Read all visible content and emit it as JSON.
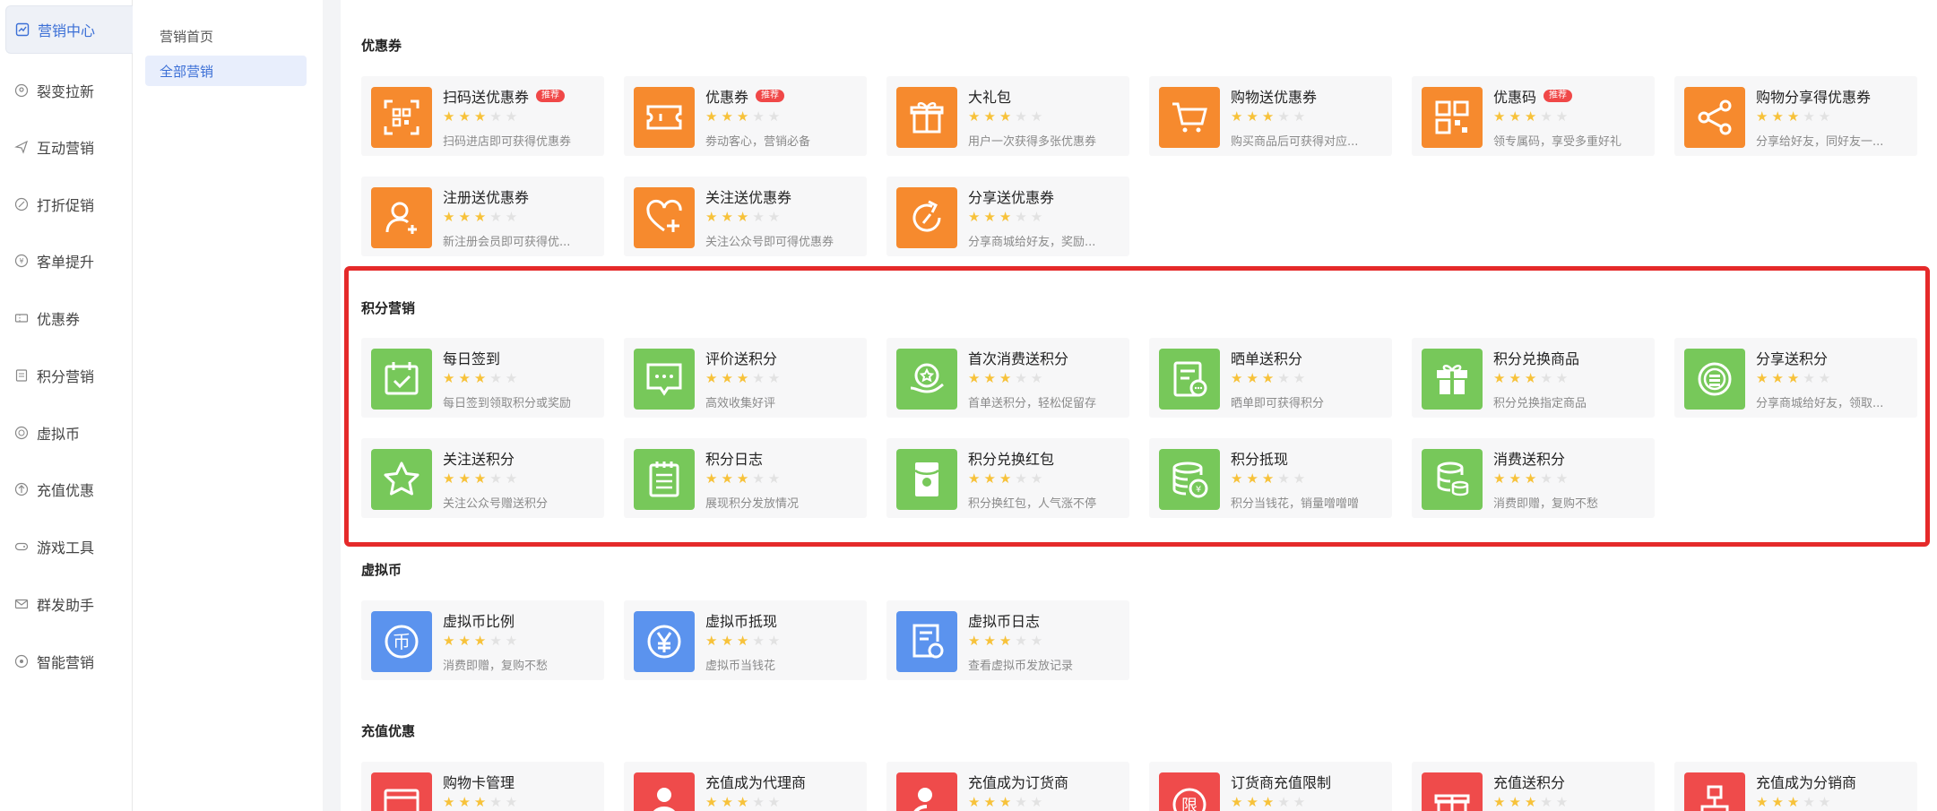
{
  "nav_primary": [
    {
      "label": "营销中心",
      "icon": "chart-icon",
      "active": true
    },
    {
      "label": "裂变拉新",
      "icon": "people-icon"
    },
    {
      "label": "互动营销",
      "icon": "send-icon"
    },
    {
      "label": "打折促销",
      "icon": "discount-icon"
    },
    {
      "label": "客单提升",
      "icon": "coin-icon"
    },
    {
      "label": "优惠券",
      "icon": "ticket-icon"
    },
    {
      "label": "积分营销",
      "icon": "points-icon"
    },
    {
      "label": "虚拟币",
      "icon": "virtual-coin-icon"
    },
    {
      "label": "充值优惠",
      "icon": "recharge-icon"
    },
    {
      "label": "游戏工具",
      "icon": "gamepad-icon"
    },
    {
      "label": "群发助手",
      "icon": "mail-icon"
    },
    {
      "label": "智能营销",
      "icon": "smart-icon"
    }
  ],
  "nav_secondary": [
    {
      "label": "营销首页"
    },
    {
      "label": "全部营销",
      "active": true
    }
  ],
  "colors": {
    "orange": "#f68a2e",
    "green": "#77c85a",
    "blue": "#5b93ee",
    "red": "#ef4b4b",
    "highlight": "#e52a2a",
    "accent": "#3b6fd6"
  },
  "sections": [
    {
      "title": "优惠券",
      "cards": [
        {
          "name": "扫码送优惠券",
          "badge": "推荐",
          "desc": "扫码进店即可获得优惠券",
          "rating": 3,
          "icon": "qr-scan-icon"
        },
        {
          "name": "优惠券",
          "badge": "推荐",
          "desc": "劵动客心，营销必备",
          "rating": 3,
          "icon": "ticket-icon"
        },
        {
          "name": "大礼包",
          "desc": "用户一次获得多张优惠券",
          "rating": 3,
          "icon": "gift-icon"
        },
        {
          "name": "购物送优惠券",
          "desc": "购买商品后可获得对应...",
          "rating": 3,
          "icon": "cart-icon"
        },
        {
          "name": "优惠码",
          "badge": "推荐",
          "desc": "领专属码，享受多重好礼",
          "rating": 3,
          "icon": "qr-code-icon"
        },
        {
          "name": "购物分享得优惠券",
          "desc": "分享给好友，同好友一...",
          "rating": 3,
          "icon": "share-icon"
        },
        {
          "name": "注册送优惠券",
          "desc": "新注册会员即可获得优...",
          "rating": 3,
          "icon": "user-add-icon"
        },
        {
          "name": "关注送优惠券",
          "desc": "关注公众号即可得优惠券",
          "rating": 3,
          "icon": "heart-add-icon"
        },
        {
          "name": "分享送优惠券",
          "desc": "分享商城给好友，奖励...",
          "rating": 3,
          "icon": "refresh-share-icon"
        }
      ]
    },
    {
      "title": "积分营销",
      "cards": [
        {
          "name": "每日签到",
          "desc": "每日签到领取积分或奖励",
          "rating": 3,
          "icon": "calendar-check-icon"
        },
        {
          "name": "评价送积分",
          "desc": "高效收集好评",
          "rating": 3,
          "icon": "comment-icon"
        },
        {
          "name": "首次消费送积分",
          "desc": "首单送积分，轻松促留存",
          "rating": 3,
          "icon": "star-hand-icon"
        },
        {
          "name": "晒单送积分",
          "desc": "晒单即可获得积分",
          "rating": 3,
          "icon": "receipt-icon"
        },
        {
          "name": "积分兑换商品",
          "desc": "积分兑换指定商品",
          "rating": 3,
          "icon": "gift-box-icon"
        },
        {
          "name": "分享送积分",
          "desc": "分享商城给好友，领取...",
          "rating": 3,
          "icon": "coins-icon"
        },
        {
          "name": "关注送积分",
          "desc": "关注公众号赠送积分",
          "rating": 3,
          "icon": "star-outline-icon"
        },
        {
          "name": "积分日志",
          "desc": "展现积分发放情况",
          "rating": 3,
          "icon": "log-icon"
        },
        {
          "name": "积分兑换红包",
          "desc": "积分换红包，人气涨不停",
          "rating": 3,
          "icon": "red-packet-icon"
        },
        {
          "name": "积分抵现",
          "desc": "积分当钱花，销量噌噌噌",
          "rating": 3,
          "icon": "coin-stack-icon"
        },
        {
          "name": "消费送积分",
          "desc": "消费即赠，复购不愁",
          "rating": 3,
          "icon": "database-icon"
        }
      ]
    },
    {
      "title": "虚拟币",
      "cards": [
        {
          "name": "虚拟币比例",
          "desc": "消费即赠，复购不愁",
          "rating": 3,
          "icon": "currency-icon"
        },
        {
          "name": "虚拟币抵现",
          "desc": "虚拟币当钱花",
          "rating": 3,
          "icon": "yen-icon"
        },
        {
          "name": "虚拟币日志",
          "desc": "查看虚拟币发放记录",
          "rating": 3,
          "icon": "doc-record-icon"
        }
      ]
    },
    {
      "title": "充值优惠",
      "cards": [
        {
          "name": "购物卡管理",
          "desc": "",
          "rating": 3,
          "icon": "card-icon"
        },
        {
          "name": "充值成为代理商",
          "desc": "",
          "rating": 3,
          "icon": "agent-icon"
        },
        {
          "name": "充值成为订货商",
          "desc": "",
          "rating": 3,
          "icon": "stamp-icon"
        },
        {
          "name": "订货商充值限制",
          "desc": "",
          "rating": 3,
          "icon": "limit-icon"
        },
        {
          "name": "充值送积分",
          "desc": "",
          "rating": 3,
          "icon": "gift-recharge-icon"
        },
        {
          "name": "充值成为分销商",
          "desc": "",
          "rating": 3,
          "icon": "org-icon"
        }
      ]
    }
  ]
}
